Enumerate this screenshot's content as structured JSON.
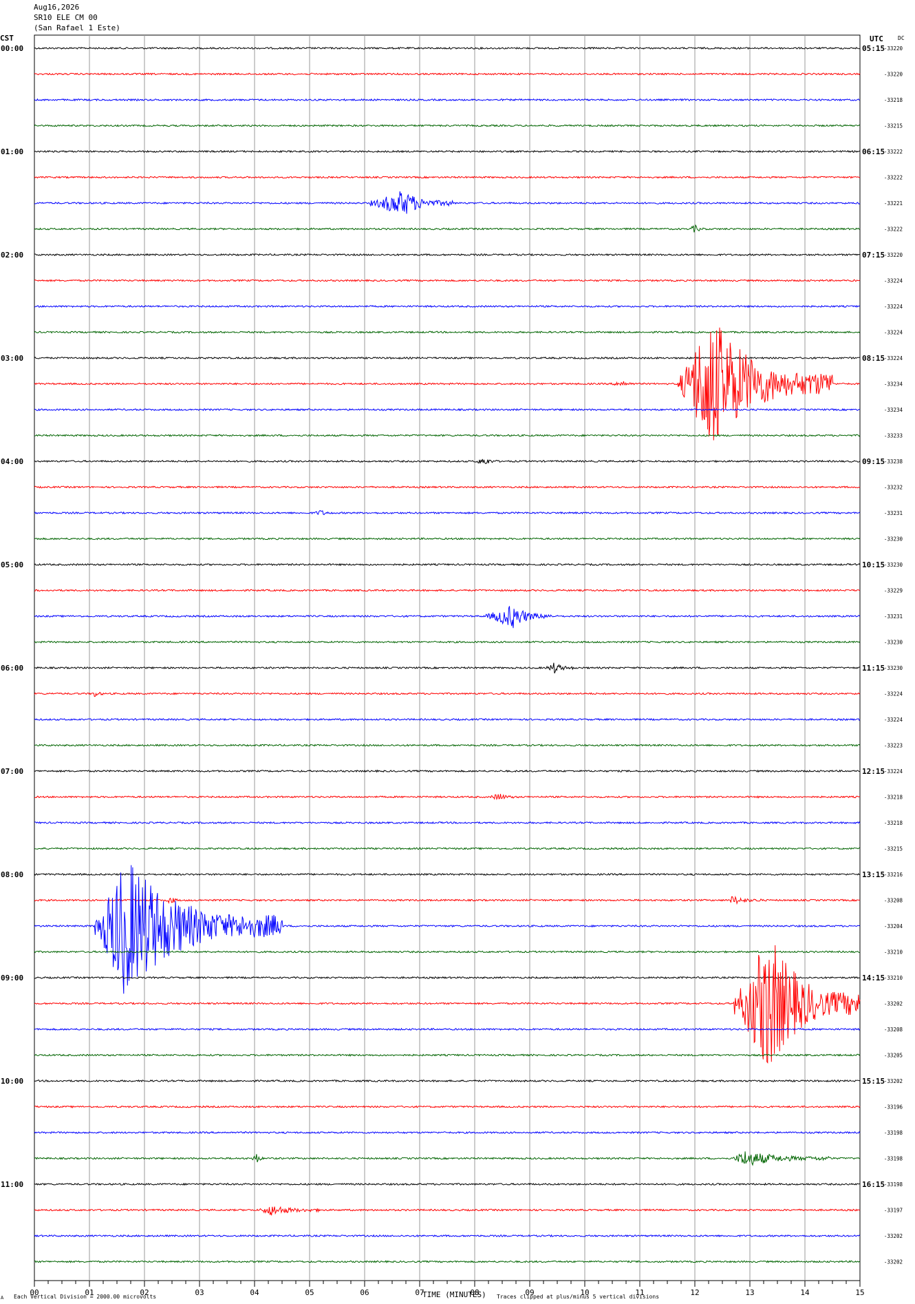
{
  "header": {
    "date": "Aug16,2026",
    "station": "SR10 ELE CM 00",
    "location": "(San Rafael 1 Este)",
    "left_axis_label": "CST",
    "right_axis_label": "UTC",
    "dc_label": "DC"
  },
  "footer": {
    "corner_mark": "A",
    "scale_note": "Each Vertical Division = 2000.00 microvolts",
    "xlabel": "TIME (MINUTES)",
    "clip_note": "Traces clipped at plus/minus 5 vertical divisions"
  },
  "chart_data": {
    "type": "line",
    "title": "SR10 ELE CM 00 (San Rafael 1 Este)",
    "date": "Aug16,2026",
    "xlabel": "TIME (MINUTES)",
    "xlim": [
      0,
      15
    ],
    "x_ticks": [
      "00",
      "01",
      "02",
      "03",
      "04",
      "05",
      "06",
      "07",
      "08",
      "09",
      "10",
      "11",
      "12",
      "13",
      "14",
      "15"
    ],
    "grid": true,
    "trace_colors": [
      "#000000",
      "#ff0000",
      "#0000ff",
      "#006400"
    ],
    "traces_per_hour": 4,
    "left_hour_labels": [
      "00:00",
      "01:00",
      "02:00",
      "03:00",
      "04:00",
      "05:00",
      "06:00",
      "07:00",
      "08:00",
      "09:00",
      "10:00",
      "11:00"
    ],
    "right_hour_labels": [
      "05:15",
      "06:15",
      "07:15",
      "08:15",
      "09:15",
      "10:15",
      "11:15",
      "12:15",
      "13:15",
      "14:15",
      "15:15",
      "16:15"
    ],
    "dc_values": [
      "-33220",
      "-33220",
      "-33218",
      "-33215",
      "-33222",
      "-33222",
      "-33221",
      "-33222",
      "-33220",
      "-33224",
      "-33224",
      "-33224",
      "-33224",
      "-33234",
      "-33234",
      "-33233",
      "-33238",
      "-33232",
      "-33231",
      "-33230",
      "-33230",
      "-33229",
      "-33231",
      "-33230",
      "-33230",
      "-33224",
      "-33224",
      "-33223",
      "-33224",
      "-33218",
      "-33218",
      "-33215",
      "-33216",
      "-33208",
      "-33204",
      "-33210",
      "-33210",
      "-33202",
      "-33208",
      "-33205",
      "-33202",
      "-33196",
      "-33198",
      "-33198",
      "-33198",
      "-33197",
      "-33202",
      "-33202"
    ],
    "events": [
      {
        "trace": 6,
        "start_min": 6.1,
        "peak_min": 6.7,
        "end_min": 7.6,
        "amplitude": 0.9
      },
      {
        "trace": 7,
        "start_min": 11.9,
        "peak_min": 12.0,
        "end_min": 12.2,
        "amplitude": 0.25
      },
      {
        "trace": 13,
        "start_min": 11.7,
        "peak_min": 12.3,
        "end_min": 14.5,
        "amplitude": 5.0
      },
      {
        "trace": 13,
        "start_min": 10.5,
        "peak_min": 10.7,
        "end_min": 10.9,
        "amplitude": 0.2
      },
      {
        "trace": 16,
        "start_min": 8.0,
        "peak_min": 8.2,
        "end_min": 8.4,
        "amplitude": 0.25
      },
      {
        "trace": 18,
        "start_min": 5.1,
        "peak_min": 5.2,
        "end_min": 5.4,
        "amplitude": 0.2
      },
      {
        "trace": 22,
        "start_min": 8.2,
        "peak_min": 8.7,
        "end_min": 9.4,
        "amplitude": 0.8
      },
      {
        "trace": 24,
        "start_min": 9.3,
        "peak_min": 9.45,
        "end_min": 9.8,
        "amplitude": 0.35
      },
      {
        "trace": 25,
        "start_min": 1.05,
        "peak_min": 1.1,
        "end_min": 1.25,
        "amplitude": 0.25
      },
      {
        "trace": 29,
        "start_min": 8.3,
        "peak_min": 8.45,
        "end_min": 8.7,
        "amplitude": 0.25
      },
      {
        "trace": 33,
        "start_min": 2.4,
        "peak_min": 2.5,
        "end_min": 2.6,
        "amplitude": 0.3
      },
      {
        "trace": 33,
        "start_min": 12.6,
        "peak_min": 12.7,
        "end_min": 13.2,
        "amplitude": 0.3
      },
      {
        "trace": 34,
        "start_min": 1.1,
        "peak_min": 1.65,
        "end_min": 4.5,
        "amplitude": 5.0
      },
      {
        "trace": 37,
        "start_min": 12.7,
        "peak_min": 13.35,
        "end_min": 15.0,
        "amplitude": 5.0
      },
      {
        "trace": 43,
        "start_min": 3.95,
        "peak_min": 4.05,
        "end_min": 4.15,
        "amplitude": 0.35
      },
      {
        "trace": 43,
        "start_min": 12.7,
        "peak_min": 12.9,
        "end_min": 14.5,
        "amplitude": 0.55
      },
      {
        "trace": 45,
        "start_min": 4.1,
        "peak_min": 4.3,
        "end_min": 5.2,
        "amplitude": 0.35
      }
    ]
  }
}
